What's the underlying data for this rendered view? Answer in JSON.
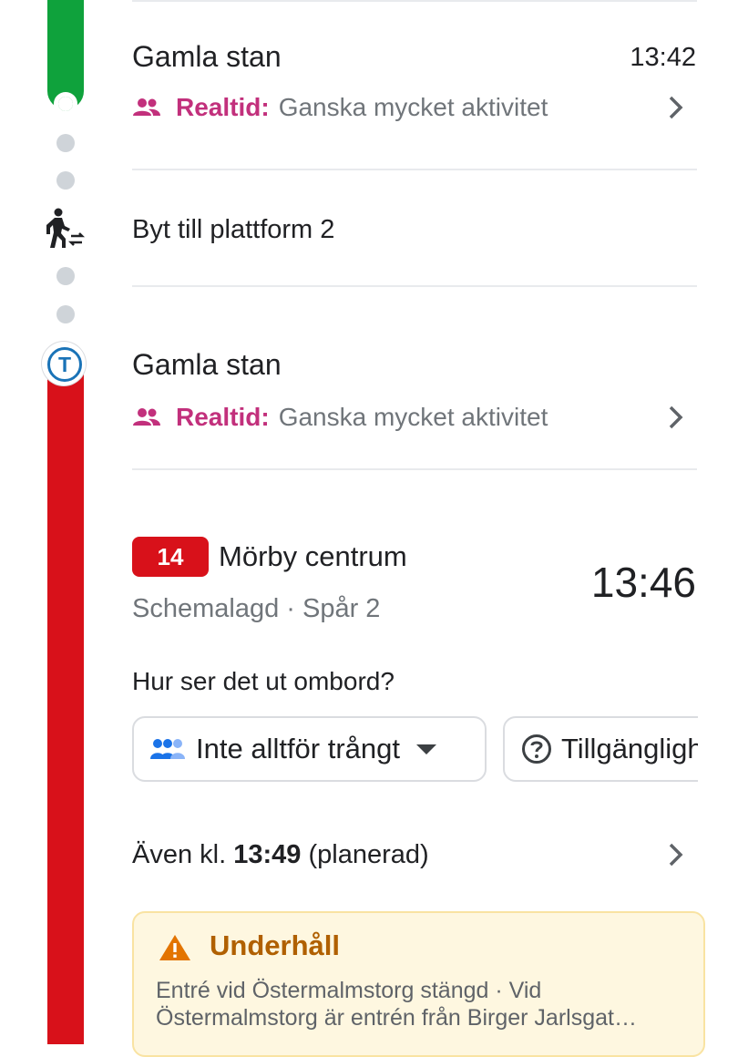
{
  "stops": [
    {
      "station": "Gamla stan",
      "time": "13:42",
      "realtime_label": "Realtid:",
      "realtime_text": "Ganska mycket aktivitet"
    },
    {
      "station": "Gamla stan",
      "realtime_label": "Realtid:",
      "realtime_text": "Ganska mycket aktivitet"
    }
  ],
  "transfer": {
    "text": "Byt till plattform 2"
  },
  "departure": {
    "line": "14",
    "destination": "Mörby centrum",
    "time": "13:46",
    "schedule": "Schemalagd · Spår 2",
    "crowd_question": "Hur ser det ut ombord?",
    "crowd_chip": "Inte alltför trångt",
    "access_chip": "Tillgänglighet"
  },
  "also": {
    "prefix": "Även kl.",
    "time": "13:49",
    "suffix": "(planerad)"
  },
  "alert": {
    "title": "Underhåll",
    "text": "Entré vid Östermalmstorg stängd · Vid Östermalmstorg är entrén från Birger Jarlsgat…"
  },
  "colors": {
    "green_line": "#0fa23c",
    "red_line": "#d8111a",
    "realtime": "#c2307c",
    "alert_title": "#b06000"
  },
  "icons": [
    "people-icon",
    "chevron-right-icon",
    "walk-transfer-icon",
    "metro-t-icon",
    "crowd-icon",
    "help-circle-icon",
    "warning-icon"
  ]
}
